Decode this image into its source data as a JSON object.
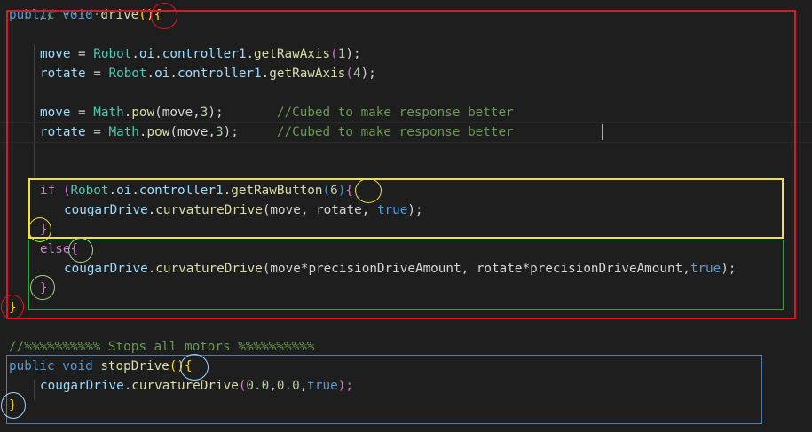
{
  "colors": {
    "red_box": "#e81123",
    "yellow_box": "#f0e040",
    "green_box": "#2ea043",
    "blue_box": "#4a7fb5",
    "background": "#1e1e1e"
  },
  "code": {
    "top_partial": "// ······",
    "l1": {
      "kw1": "public",
      "kw2": "void",
      "fn": "drive",
      "paren": "()",
      "brace": "{"
    },
    "l2": {
      "var": "move",
      "eq": " = ",
      "cls": "Robot",
      "dot1": ".",
      "oi": "oi",
      "dot2": ".",
      "ctl": "controller1",
      "dot3": ".",
      "fn": "getRawAxis",
      "open": "(",
      "num": "1",
      "close": ");"
    },
    "l3": {
      "var": "rotate",
      "eq": " = ",
      "cls": "Robot",
      "dot1": ".",
      "oi": "oi",
      "dot2": ".",
      "ctl": "controller1",
      "dot3": ".",
      "fn": "getRawAxis",
      "open": "(",
      "num": "4",
      "close": ");"
    },
    "l4": {
      "var": "move",
      "eq": " = ",
      "cls": "Math",
      "dot": ".",
      "fn": "pow",
      "args": "(move,",
      "num": "3",
      "close": ");",
      "pad": "       ",
      "comment": "//Cubed to make response better"
    },
    "l5": {
      "var": "rotate",
      "eq": " = ",
      "cls": "Math",
      "dot": ".",
      "fn": "pow",
      "args": "(move,",
      "num": "3",
      "close": ");",
      "pad": "     ",
      "comment": "//Cubed to make response better"
    },
    "l6": {
      "kw": "if",
      "sp": " (",
      "cls": "Robot",
      "dot1": ".",
      "oi": "oi",
      "dot2": ".",
      "ctl": "controller1",
      "dot3": ".",
      "fn": "getRawButton",
      "open": "(",
      "num": "6",
      "close": ")",
      "brace": "{"
    },
    "l7": {
      "obj": "cougarDrive",
      "dot": ".",
      "fn": "curvatureDrive",
      "args": "(move, rotate, ",
      "bool": "true",
      "close": ");"
    },
    "l8": {
      "brace": "}"
    },
    "l9": {
      "kw": "else",
      "brace": "{"
    },
    "l10": {
      "obj": "cougarDrive",
      "dot": ".",
      "fn": "curvatureDrive",
      "args": "(move*precisionDriveAmount, rotate*precisionDriveAmount,",
      "bool": "true",
      "close": ");"
    },
    "l11": {
      "brace": "}"
    },
    "l12": {
      "brace": "}"
    },
    "l13": {
      "comment": "//%%%%%%%%%% Stops all motors %%%%%%%%%%"
    },
    "l14": {
      "kw1": "public",
      "kw2": "void",
      "fn": "stopDrive",
      "paren": "()",
      "brace": "{"
    },
    "l15": {
      "obj": "cougarDrive",
      "dot": ".",
      "fn": "curvatureDrive",
      "args": "(",
      "n1": "0.0",
      "c1": ",",
      "n2": "0.0",
      "c2": ",",
      "bool": "true",
      "close": ");"
    },
    "l16": {
      "brace": "}"
    }
  }
}
